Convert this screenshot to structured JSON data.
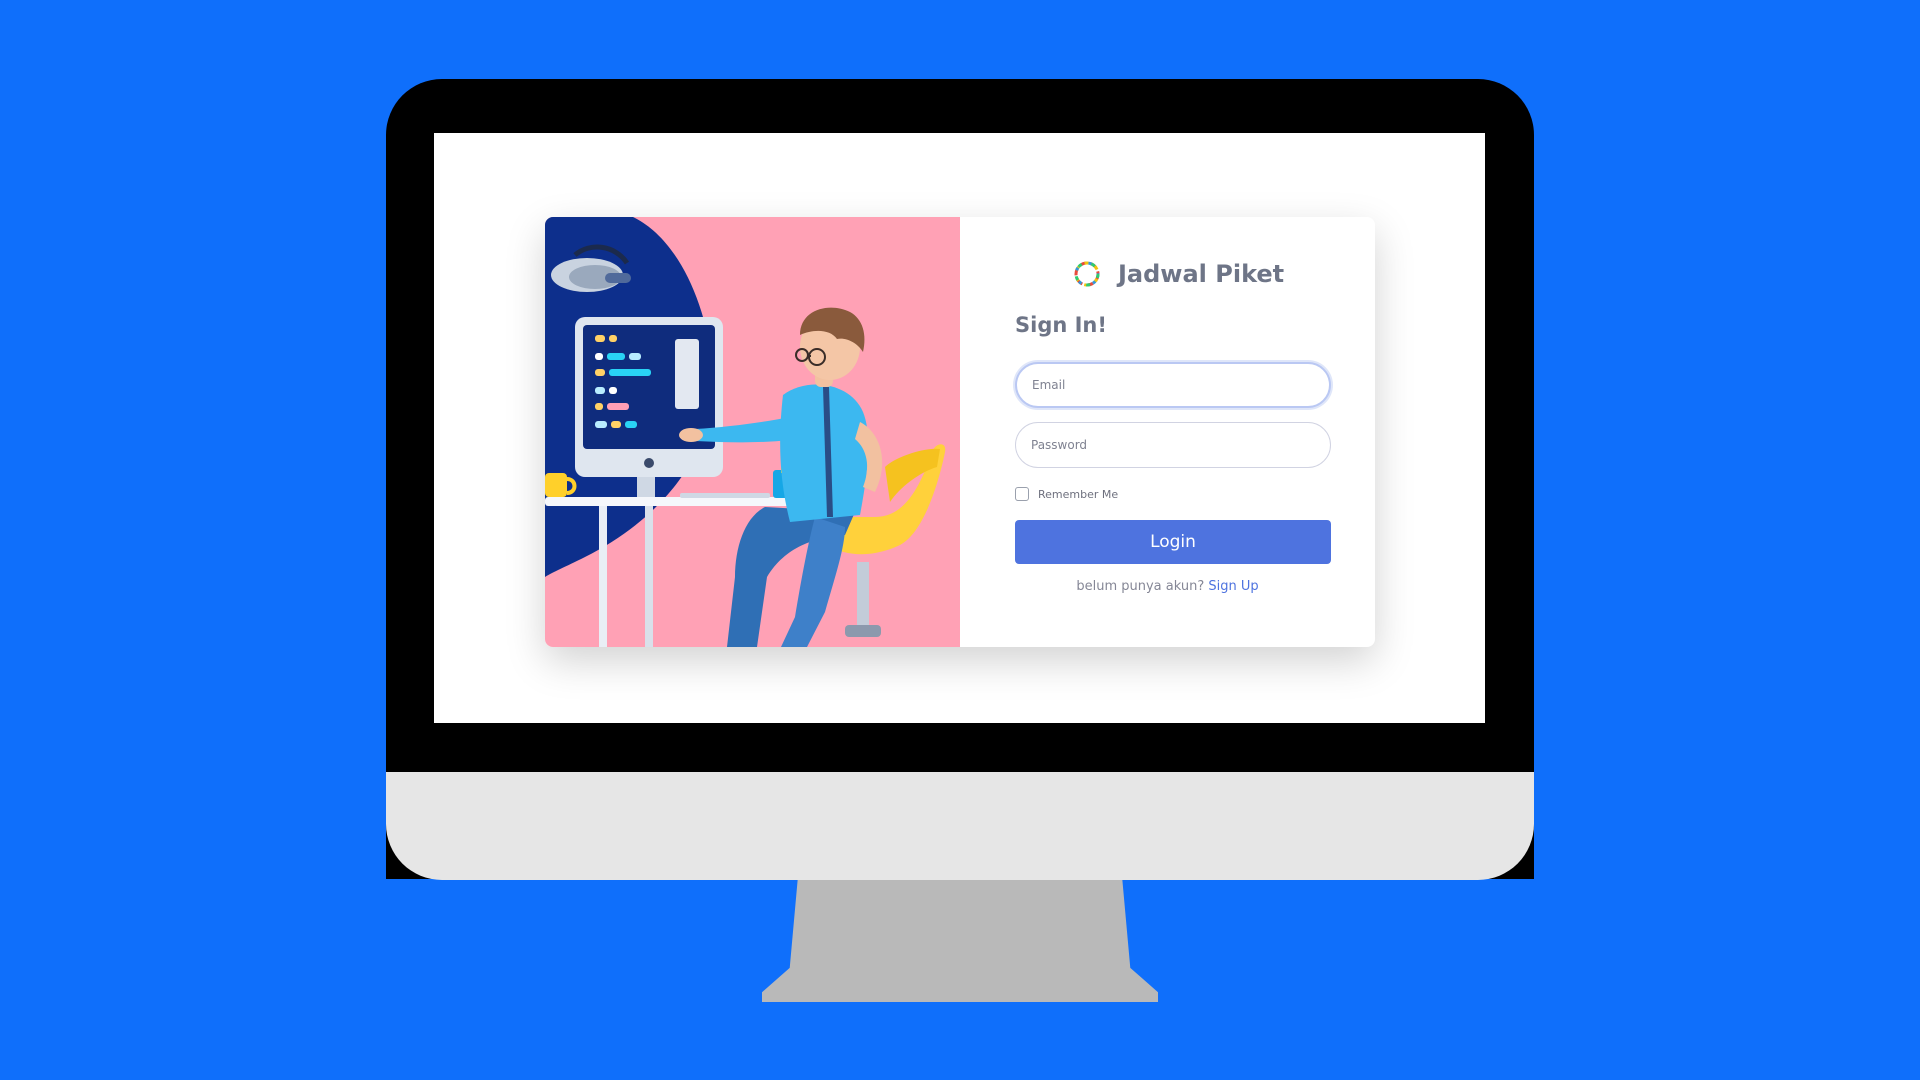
{
  "app": {
    "brand_name": "Jadwal Piket",
    "logo_icon": "ring-logo-icon"
  },
  "login": {
    "heading": "Sign In!",
    "email_placeholder": "Email",
    "password_placeholder": "Password",
    "remember_label": "Remember Me",
    "remember_checked": false,
    "submit_label": "Login",
    "signup_prompt": "belum punya akun?",
    "signup_link": "Sign Up"
  },
  "colors": {
    "background": "#0f6ffb",
    "primary": "#4e73df",
    "illustration_bg": "#ffa1b5",
    "text_muted": "#6e7587"
  },
  "illustration": {
    "icon": "developer-at-desk-illustration"
  }
}
